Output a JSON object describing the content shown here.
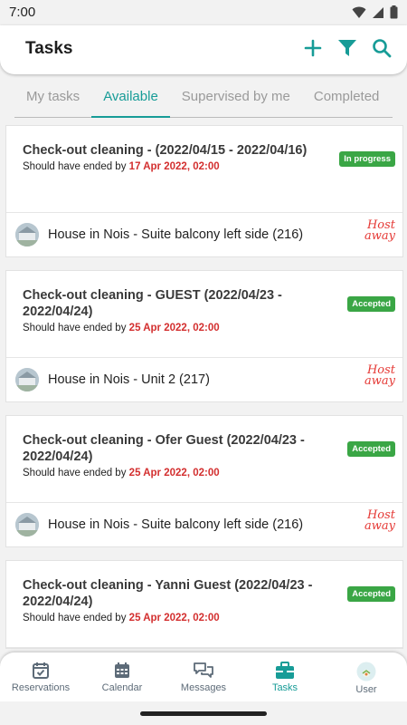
{
  "status": {
    "time": "7:00"
  },
  "header": {
    "title": "Tasks"
  },
  "colors": {
    "accent": "#179c97",
    "badge": "#3aa645",
    "date_red": "#d32f2f",
    "hostaway": "#e53935"
  },
  "tabs": [
    {
      "label": "My tasks",
      "active": false
    },
    {
      "label": "Available",
      "active": true
    },
    {
      "label": "Supervised by me",
      "active": false
    },
    {
      "label": "Completed",
      "active": false
    }
  ],
  "tasks": [
    {
      "title": "Check-out cleaning - (2022/04/15 - 2022/04/16)",
      "sub_prefix": "Should have ended by",
      "due": "17 Apr 2022, 02:00",
      "status": "In progress",
      "property": "House in Nois - Suite balcony left side (216)",
      "source_line1": "Host",
      "source_line2": "away"
    },
    {
      "title": "Check-out cleaning - GUEST (2022/04/23 - 2022/04/24)",
      "sub_prefix": "Should have ended by",
      "due": "25 Apr 2022, 02:00",
      "status": "Accepted",
      "property": "House in Nois - Unit 2 (217)",
      "source_line1": "Host",
      "source_line2": "away"
    },
    {
      "title": "Check-out cleaning - Ofer Guest (2022/04/23 - 2022/04/24)",
      "sub_prefix": "Should have ended by",
      "due": "25 Apr 2022, 02:00",
      "status": "Accepted",
      "property": "House in Nois - Suite balcony left side (216)",
      "source_line1": "Host",
      "source_line2": "away"
    },
    {
      "title": "Check-out cleaning - Yanni Guest (2022/04/23 - 2022/04/24)",
      "sub_prefix": "Should have ended by",
      "due": "25 Apr 2022, 02:00",
      "status": "Accepted",
      "property": "",
      "source_line1": "",
      "source_line2": ""
    }
  ],
  "nav": [
    {
      "label": "Reservations",
      "icon": "calendar-check-icon",
      "active": false
    },
    {
      "label": "Calendar",
      "icon": "calendar-grid-icon",
      "active": false
    },
    {
      "label": "Messages",
      "icon": "chat-bubbles-icon",
      "active": false
    },
    {
      "label": "Tasks",
      "icon": "briefcase-icon",
      "active": true
    },
    {
      "label": "User",
      "icon": "user-avatar-icon",
      "active": false
    }
  ]
}
